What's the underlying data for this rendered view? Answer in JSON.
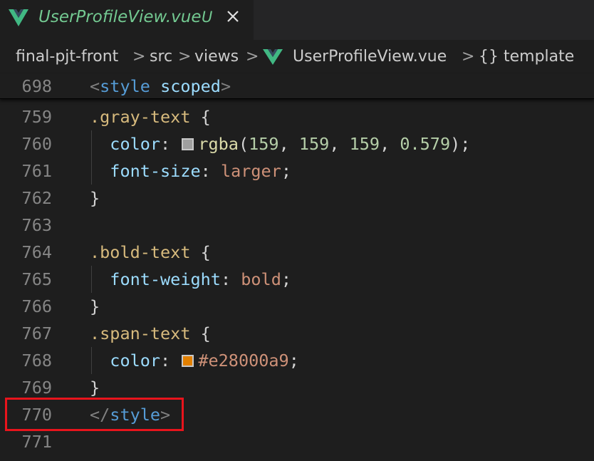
{
  "tab": {
    "title": "UserProfileView.vue",
    "status": "U",
    "icon": "vue-logo-icon",
    "title_color": "#73c991"
  },
  "breadcrumb": {
    "items": [
      "final-pjt-front",
      "src",
      "views",
      "UserProfileView.vue",
      "template"
    ],
    "separator": ">",
    "template_icon": "{}"
  },
  "sticky_line": {
    "number": "698",
    "tag_open": "<",
    "tag_name": "style",
    "attr": "scoped",
    "tag_close": ">"
  },
  "code_lines": [
    {
      "number": "759",
      "selector": ".gray-text",
      "brace": "{"
    },
    {
      "number": "760",
      "property": "color",
      "colon": ":",
      "swatch_color": "#9f9f9f",
      "fn": "rgba",
      "args": [
        "159",
        "159",
        "159",
        "0.579"
      ],
      "semicolon": ");"
    },
    {
      "number": "761",
      "property": "font-size",
      "colon": ":",
      "value": "larger",
      "semicolon": ";"
    },
    {
      "number": "762",
      "brace": "}"
    },
    {
      "number": "763"
    },
    {
      "number": "764",
      "selector": ".bold-text",
      "brace": "{"
    },
    {
      "number": "765",
      "property": "font-weight",
      "colon": ":",
      "value": "bold",
      "semicolon": ";"
    },
    {
      "number": "766",
      "brace": "}"
    },
    {
      "number": "767",
      "selector": ".span-text",
      "brace": "{"
    },
    {
      "number": "768",
      "property": "color",
      "colon": ":",
      "swatch_color": "#e28000",
      "value": "#e28000a9",
      "semicolon": ";"
    },
    {
      "number": "769",
      "brace": "}"
    },
    {
      "number": "770",
      "tag_open": "</",
      "tag_name": "style",
      "tag_close": ">"
    },
    {
      "number": "771"
    }
  ],
  "colors": {
    "editor_bg": "#1e1e1e",
    "tabbar_bg": "#252526",
    "highlight": "#e8141c",
    "line_number": "#858585"
  }
}
